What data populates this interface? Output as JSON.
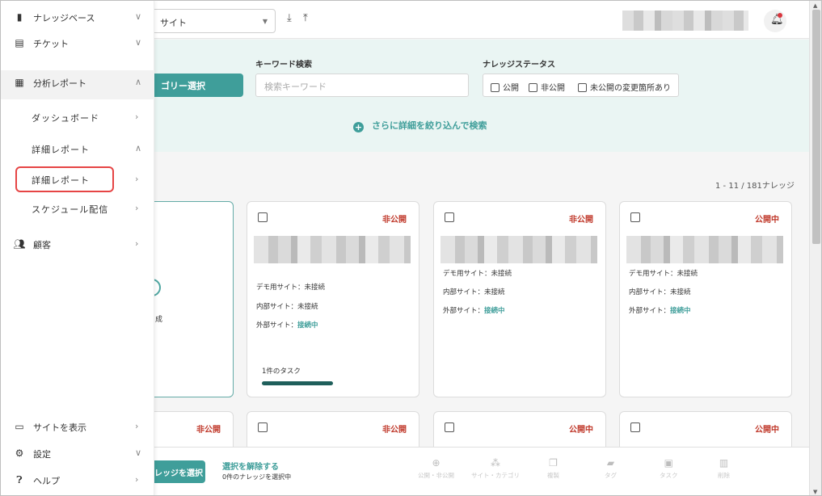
{
  "topbar": {
    "site_select": "デモ用サイト",
    "site_select_visible": "サイト"
  },
  "sidebar": {
    "items": [
      {
        "label": "ナレッジベース",
        "icon": "file-icon",
        "arrow": "∨"
      },
      {
        "label": "チケット",
        "icon": "ticket-icon",
        "arrow": "∨"
      },
      {
        "label": "分析レポート",
        "icon": "chart-icon",
        "arrow": "∧"
      },
      {
        "label": "ダッシュボード",
        "arrow": "›"
      },
      {
        "label": "詳細レポート",
        "arrow": "∧"
      },
      {
        "label": "詳細レポート",
        "arrow": "›"
      },
      {
        "label": "スケジュール配信",
        "arrow": "›"
      },
      {
        "label": "顧客",
        "icon": "people-icon",
        "arrow": "›"
      },
      {
        "label": "サイトを表示",
        "icon": "monitor-icon",
        "arrow": "›"
      },
      {
        "label": "設定",
        "icon": "gear-icon",
        "arrow": "∨"
      },
      {
        "label": "ヘルプ",
        "icon": "help-icon",
        "arrow": "›"
      }
    ]
  },
  "search": {
    "category_button": "ゴリー選択",
    "keyword_label": "キーワード検索",
    "keyword_placeholder": "検索キーワード",
    "status_label": "ナレッジステータス",
    "status_options": [
      "公開",
      "非公開",
      "未公開の変更箇所あり"
    ],
    "more_search": "さらに詳細を絞り込んで検索"
  },
  "list": {
    "count": "1 - 11 / 181ナレッジ",
    "add_card_text": "成"
  },
  "cards": [
    {
      "status": "非公開",
      "line1": "デモ用サイト：未接続",
      "line2": "内部サイト：未接続",
      "line3_prefix": "外部サイト：",
      "line3_value": "接続中",
      "task": "1件のタスク"
    },
    {
      "status": "非公開",
      "line1": "デモ用サイト：未接続",
      "line2": "内部サイト：未接続",
      "line3_prefix": "外部サイト：",
      "line3_value": "接続中"
    },
    {
      "status": "公開中",
      "line1": "デモ用サイト：未接続",
      "line2": "内部サイト：未接続",
      "line3_prefix": "外部サイト：",
      "line3_value": "接続中"
    }
  ],
  "row2": [
    {
      "status": "非公開"
    },
    {
      "status": "非公開"
    },
    {
      "status": "公開中"
    },
    {
      "status": "公開中"
    }
  ],
  "bottombar": {
    "select_button": "レッジを選択",
    "unselect": "選択を解除する",
    "selected_count": "0件のナレッジを選択中",
    "actions": [
      {
        "label": "公開・非公開",
        "icon": "globe-icon"
      },
      {
        "label": "サイト・カテゴリ",
        "icon": "sitemap-icon"
      },
      {
        "label": "複製",
        "icon": "copy-icon"
      },
      {
        "label": "タグ",
        "icon": "tag-icon"
      },
      {
        "label": "タスク",
        "icon": "task-icon"
      },
      {
        "label": "削除",
        "icon": "trash-icon"
      }
    ]
  },
  "colors": {
    "accent": "#3f9e9a",
    "status_red": "#c0392b",
    "highlight": "#e64545"
  }
}
